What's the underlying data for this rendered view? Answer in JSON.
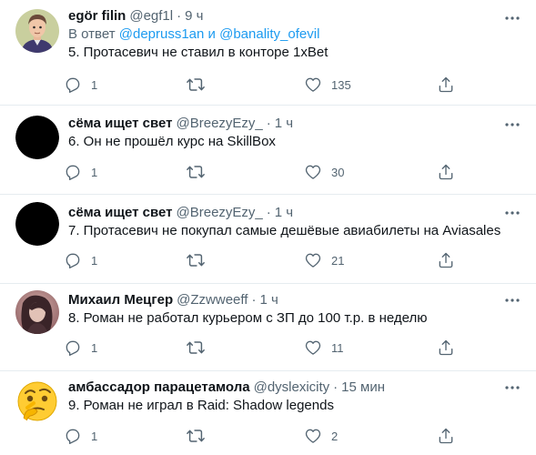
{
  "colors": {
    "accent": "#1d9bf0",
    "text_primary": "#0f1419",
    "text_secondary": "#536471",
    "divider": "#e6ecf0"
  },
  "tweets": [
    {
      "avatar": "cartoon-portrait-avatar",
      "name": "egör filin",
      "handle": "@egf1l",
      "time": "9 ч",
      "reply_prefix": "В ответ",
      "reply_mention_1": "@depruss1an",
      "reply_and": "и",
      "reply_mention_2": "@banality_ofevil",
      "text": "5. Протасевич не ставил в конторе 1xBet",
      "replies": "1",
      "retweets": "",
      "likes": "135"
    },
    {
      "avatar": "black-avatar",
      "name": "сёма ищет свет",
      "handle": "@BreezyEzy_",
      "time": "1 ч",
      "text": "6. Он не прошёл курс на SkillBox",
      "replies": "1",
      "retweets": "",
      "likes": "30"
    },
    {
      "avatar": "black-avatar",
      "name": "сёма ищет свет",
      "handle": "@BreezyEzy_",
      "time": "1 ч",
      "text": "7. Протасевич не покупал самые дешёвые авиабилеты на Aviasales",
      "replies": "1",
      "retweets": "",
      "likes": "21"
    },
    {
      "avatar": "photo-avatar",
      "name": "Михаил Мецгер",
      "handle": "@Zzwweeff",
      "time": "1 ч",
      "text": "8. Роман не работал курьером с ЗП до 100 т.р. в неделю",
      "replies": "1",
      "retweets": "",
      "likes": "11"
    },
    {
      "avatar": "thinking-emoji-avatar",
      "name": "амбассадор парацетамола",
      "handle": "@dyslexicity",
      "time": "15 мин",
      "text": "9. Роман не играл в Raid: Shadow legends",
      "replies": "1",
      "retweets": "",
      "likes": "2"
    }
  ]
}
